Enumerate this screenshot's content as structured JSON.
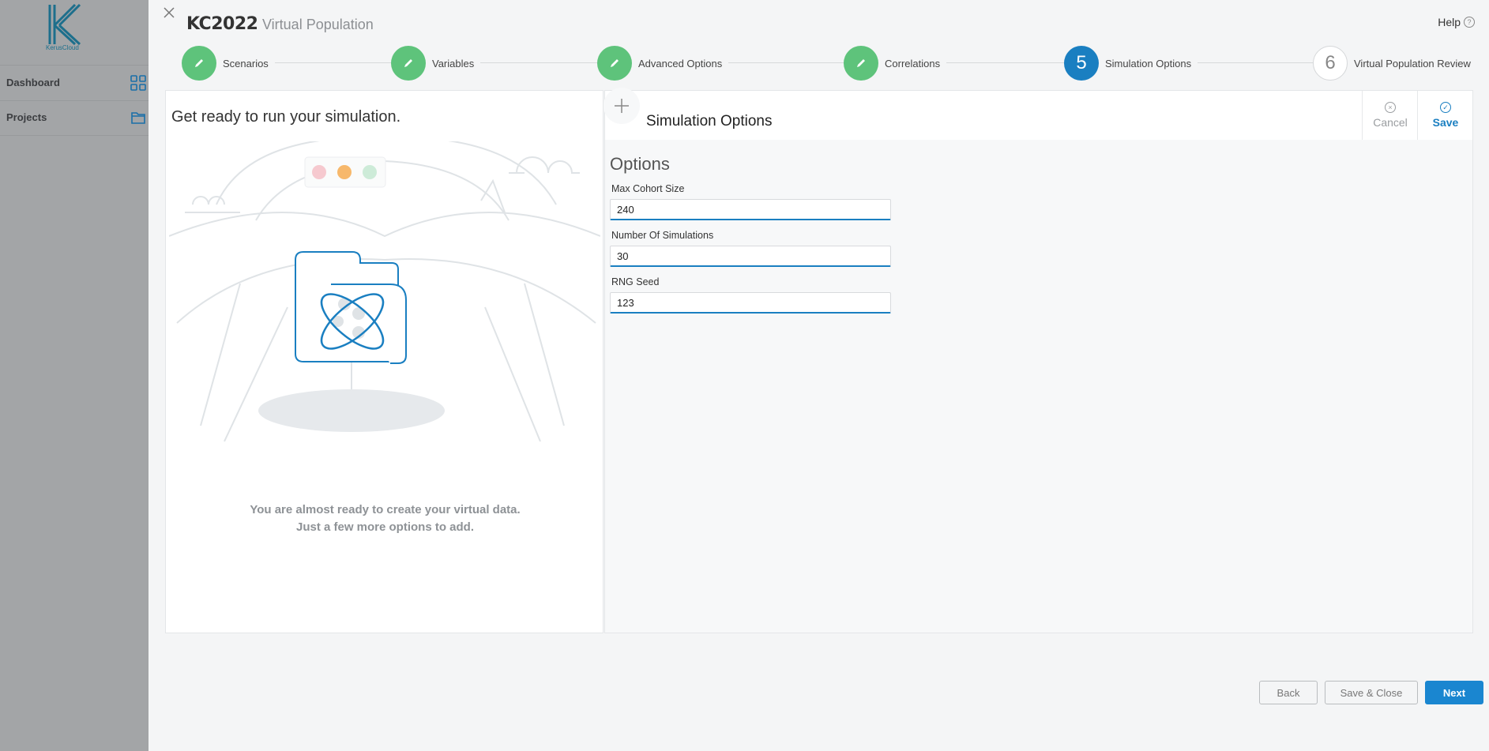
{
  "shell": {
    "logo_text": "KerusCloud",
    "nav": [
      {
        "label": "Dashboard",
        "icon": "grid-icon"
      },
      {
        "label": "Projects",
        "icon": "folder-icon"
      }
    ]
  },
  "modal": {
    "title": "KC2022",
    "subtitle": "Virtual Population",
    "help_label": "Help",
    "steps": [
      {
        "label": "Scenarios",
        "state": "done"
      },
      {
        "label": "Variables",
        "state": "done"
      },
      {
        "label": "Advanced Options",
        "state": "done"
      },
      {
        "label": "Correlations",
        "state": "done"
      },
      {
        "label": "Simulation Options",
        "state": "active",
        "number": "5"
      },
      {
        "label": "Virtual Population Review",
        "state": "todo",
        "number": "6"
      }
    ],
    "left": {
      "heading": "Get ready to run your simulation.",
      "message_line1": "You are almost ready to create your virtual data.",
      "message_line2": "Just a few more options to add."
    },
    "right": {
      "header_title": "Simulation Options",
      "cancel_label": "Cancel",
      "save_label": "Save",
      "options_title": "Options",
      "fields": [
        {
          "label": "Max Cohort Size",
          "value": "240"
        },
        {
          "label": "Number Of Simulations",
          "value": "30"
        },
        {
          "label": "RNG Seed",
          "value": "123"
        }
      ]
    },
    "footer": {
      "back_label": "Back",
      "save_close_label": "Save & Close",
      "next_label": "Next"
    }
  },
  "colors": {
    "done": "#5ec37b",
    "active": "#1a7fc1",
    "primary_button": "#1a86d0"
  }
}
